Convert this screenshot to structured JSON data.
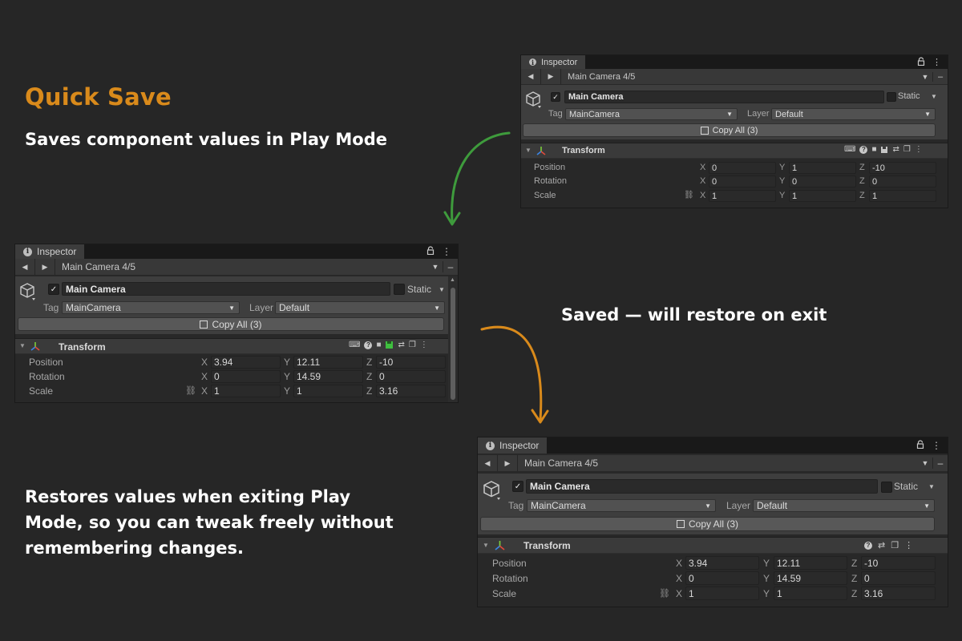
{
  "heading": "Quick Save",
  "captions": {
    "top": "Saves component values in Play Mode",
    "middle": "Saved — will restore on exit",
    "bottom": "Restores values when exiting Play Mode, so you can tweak freely without remembering changes."
  },
  "colors": {
    "heading": "#d98a1b",
    "arrow_green": "#3e9b3c",
    "arrow_orange": "#d98a1b",
    "background": "#262626"
  },
  "inspector": {
    "tab_label": "Inspector",
    "nav_title": "Main Camera  4/5",
    "object_name": "Main Camera",
    "active_checked": true,
    "static_label": "Static",
    "tag_label": "Tag",
    "tag_value": "MainCamera",
    "layer_label": "Layer",
    "layer_value": "Default",
    "copy_all_label": "Copy All (3)",
    "component_name": "Transform",
    "row_labels": {
      "position": "Position",
      "rotation": "Rotation",
      "scale": "Scale"
    },
    "axis_labels": {
      "x": "X",
      "y": "Y",
      "z": "Z"
    }
  },
  "panels": {
    "before": {
      "position": {
        "x": "0",
        "y": "1",
        "z": "-10"
      },
      "rotation": {
        "x": "0",
        "y": "0",
        "z": "0"
      },
      "scale": {
        "x": "1",
        "y": "1",
        "z": "1"
      }
    },
    "playmode": {
      "position": {
        "x": "3.94",
        "y": "12.11",
        "z": "-10"
      },
      "rotation": {
        "x": "0",
        "y": "14.59",
        "z": "0"
      },
      "scale": {
        "x": "1",
        "y": "1",
        "z": "3.16"
      },
      "saved_indicator": "green-save-icon"
    },
    "after": {
      "position": {
        "x": "3.94",
        "y": "12.11",
        "z": "-10"
      },
      "rotation": {
        "x": "0",
        "y": "14.59",
        "z": "0"
      },
      "scale": {
        "x": "1",
        "y": "1",
        "z": "3.16"
      }
    }
  }
}
